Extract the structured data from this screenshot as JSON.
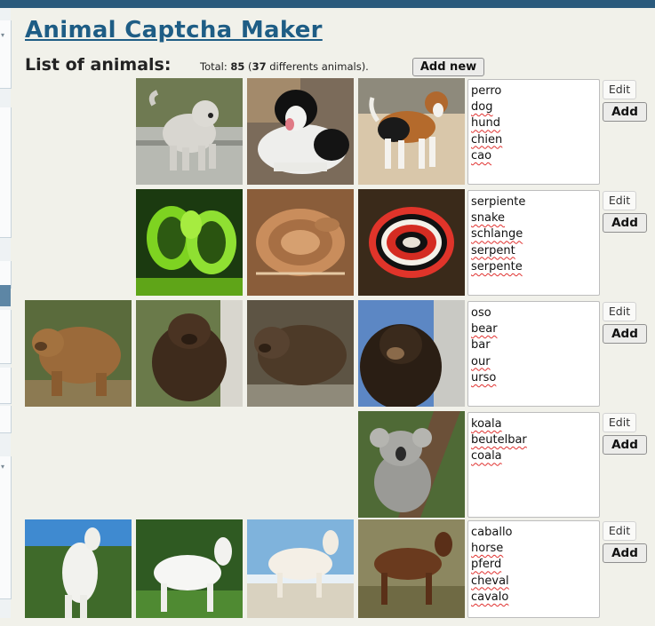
{
  "page": {
    "title": "Animal Captcha Maker",
    "list_label": "List of animals:",
    "total_prefix": "Total: ",
    "total_count": "85",
    "total_open": " (",
    "distinct_count": "37",
    "total_suffix": " differents animals).",
    "add_new_label": "Add new"
  },
  "animals": [
    {
      "id": "dog",
      "names": [
        "perro",
        "dog",
        "hund",
        "chien",
        "cao"
      ],
      "edit_label": "Edit",
      "add_label": "Add"
    },
    {
      "id": "snake",
      "names": [
        "serpiente",
        "snake",
        "schlange",
        "serpent",
        "serpente"
      ],
      "edit_label": "Edit",
      "add_label": "Add"
    },
    {
      "id": "bear",
      "names": [
        "oso",
        "bear",
        "bar",
        "our",
        "urso"
      ],
      "edit_label": "Edit",
      "add_label": "Add"
    },
    {
      "id": "koala",
      "names": [
        "koala",
        "beutelbar",
        "coala"
      ],
      "edit_label": "Edit",
      "add_label": "Add"
    },
    {
      "id": "horse",
      "names": [
        "caballo",
        "horse",
        "pferd",
        "cheval",
        "cavalo"
      ],
      "edit_label": "Edit",
      "add_label": "Add"
    }
  ],
  "colors": {
    "topbar": "#2a5a7c",
    "title": "#1e5d85",
    "background": "#f1f1ea",
    "spellcheck": "#e0312f"
  },
  "photos": [
    "dog-photo",
    "snake-photo",
    "bear-photo",
    "koala-photo",
    "horse-photo"
  ]
}
